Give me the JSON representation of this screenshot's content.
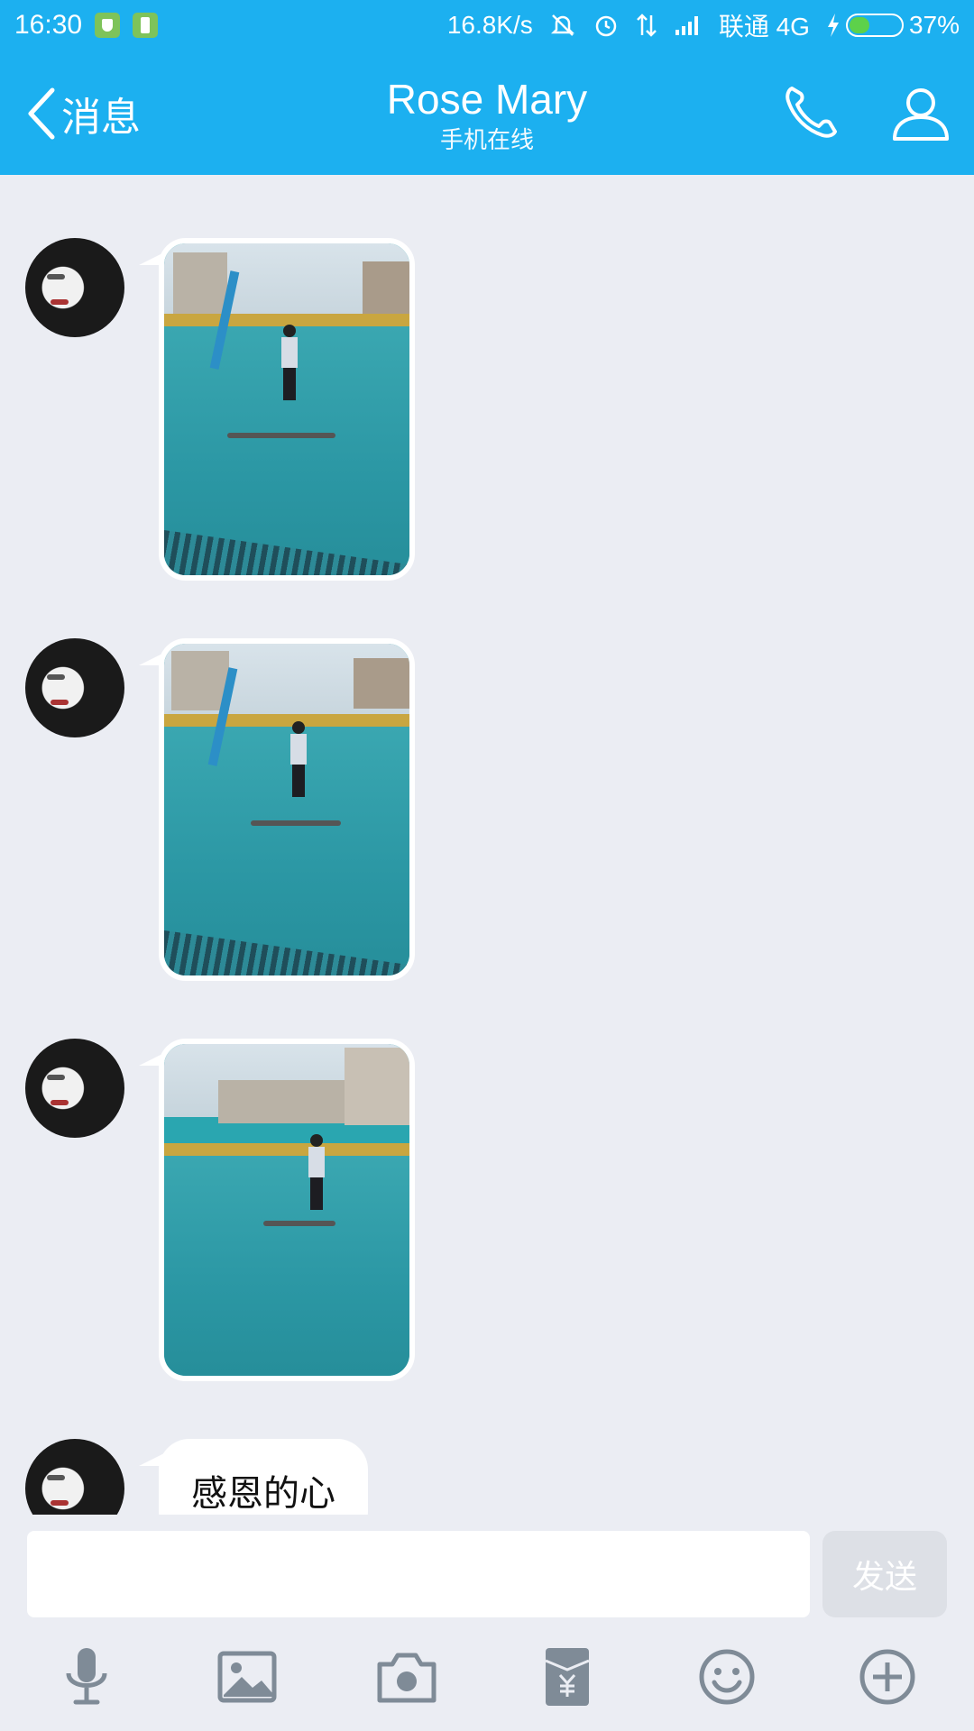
{
  "status_bar": {
    "time": "16:30",
    "network_speed": "16.8K/s",
    "carrier": "联通 4G",
    "battery_percent": "37%",
    "battery_level": 0.37
  },
  "header": {
    "back_label": "消息",
    "contact_name": "Rose Mary",
    "presence": "手机在线"
  },
  "messages": [
    {
      "type": "image",
      "icon": "photo-basketball-court"
    },
    {
      "type": "image",
      "icon": "photo-basketball-court"
    },
    {
      "type": "image",
      "icon": "photo-basketball-court"
    },
    {
      "type": "text",
      "text": "感恩的心"
    }
  ],
  "input": {
    "value": "",
    "send_label": "发送"
  },
  "toolbar": [
    "mic-icon",
    "image-icon",
    "camera-icon",
    "red-packet-icon",
    "emoji-icon",
    "plus-icon"
  ],
  "colors": {
    "header_bg": "#1cb0f0",
    "chat_bg": "#ebedf3",
    "send_disabled": "#dde0e6"
  }
}
